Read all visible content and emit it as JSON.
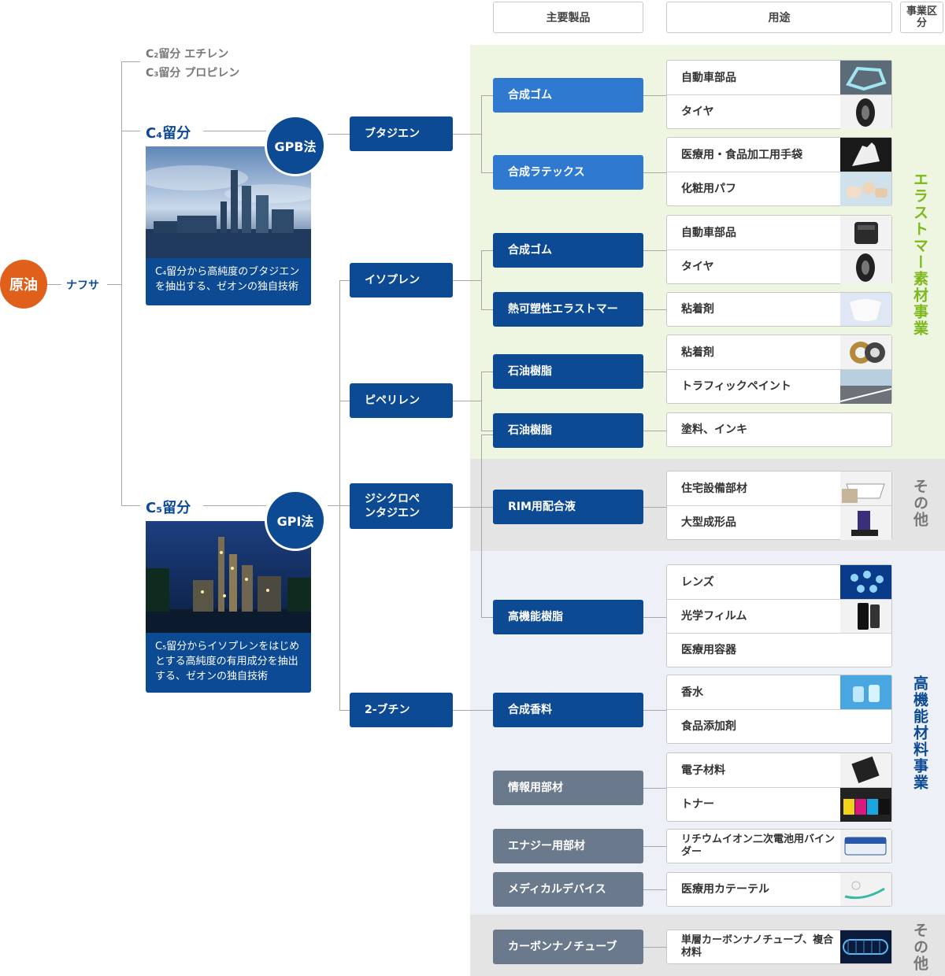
{
  "headers": {
    "products": "主要製品",
    "uses": "用途",
    "segment": "事業区分"
  },
  "source": {
    "crude": "原油",
    "naphtha": "ナフサ"
  },
  "fractions": {
    "c2": "C₂留分 エチレン",
    "c3": "C₃留分 プロピレン",
    "c4": "C₄留分",
    "c5": "C₅留分"
  },
  "methods": {
    "gpb": "GPB法",
    "gpi": "GPI法"
  },
  "captions": {
    "gpb": "C₄留分から高純度のブタジエンを抽出する、ゼオンの独自技術",
    "gpi": "C₅留分からイソプレンをはじめとする高純度の有用成分を抽出する、ゼオンの独自技術"
  },
  "materials": [
    "ブタジエン",
    "イソプレン",
    "ピペリレン",
    "ジシクロペンタジエン",
    "2-ブチン"
  ],
  "products": [
    "合成ゴム",
    "合成ラテックス",
    "合成ゴム",
    "熱可塑性エラストマー",
    "石油樹脂",
    "石油樹脂",
    "RIM用配合液",
    "高機能樹脂",
    "合成香料",
    "情報用部材",
    "エナジー用部材",
    "メディカルデバイス",
    "カーボンナノチューブ"
  ],
  "uses": [
    [
      "自動車部品",
      "タイヤ"
    ],
    [
      "医療用・食品加工用手袋",
      "化粧用パフ"
    ],
    [
      "自動車部品",
      "タイヤ"
    ],
    [
      "粘着剤"
    ],
    [
      "粘着剤",
      "トラフィックペイント"
    ],
    [
      "塗料、インキ"
    ],
    [
      "住宅設備部材",
      "大型成形品"
    ],
    [
      "レンズ",
      "光学フィルム",
      "医療用容器"
    ],
    [
      "香水",
      "食品添加剤"
    ],
    [
      "電子材料",
      "トナー"
    ],
    [
      "リチウムイオン二次電池用バインダー"
    ],
    [
      "医療用カテーテル"
    ],
    [
      "単層カーボンナノチューブ、複合材料"
    ]
  ],
  "segments": {
    "elastomer": "エラストマー素材事業",
    "other1": "その他",
    "specialty": "高機能材料事業",
    "other2": "その他"
  },
  "colors": {
    "navy": "#0d4a94",
    "blue": "#2f7ad0",
    "gray": "#6a7a8c",
    "orange": "#e0601b",
    "elastomer_band": "#eef6e1",
    "other_band": "#e4e4e4",
    "specialty_band": "#eef0f8"
  }
}
